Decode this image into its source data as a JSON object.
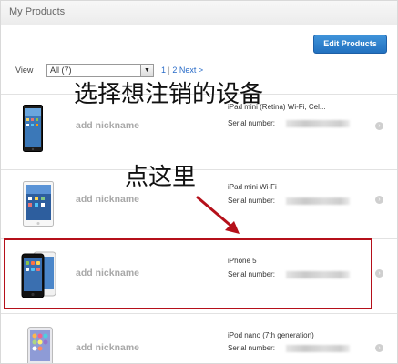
{
  "window": {
    "title": "My Products"
  },
  "toolbar": {
    "edit_label": "Edit Products"
  },
  "view": {
    "label": "View",
    "selected": "All (7)",
    "pages": [
      "1",
      "2"
    ],
    "separator": "|",
    "next": "Next >"
  },
  "devices": [
    {
      "nickname": "add nickname",
      "name": "iPad mini (Retina) Wi-Fi, Cel...",
      "serial_label": "Serial number:"
    },
    {
      "nickname": "add nickname",
      "name": "iPad mini Wi-Fi",
      "serial_label": "Serial number:"
    },
    {
      "nickname": "add nickname",
      "name": "iPhone 5",
      "serial_label": "Serial number:"
    },
    {
      "nickname": "add nickname",
      "name": "iPod nano (7th generation)",
      "serial_label": "Serial number:"
    }
  ],
  "annotations": {
    "select_device": "选择想注销的设备",
    "click_here": "点这里"
  },
  "colors": {
    "highlight": "#b5101a",
    "button": "#2a78c6",
    "link": "#2a6cc8"
  }
}
